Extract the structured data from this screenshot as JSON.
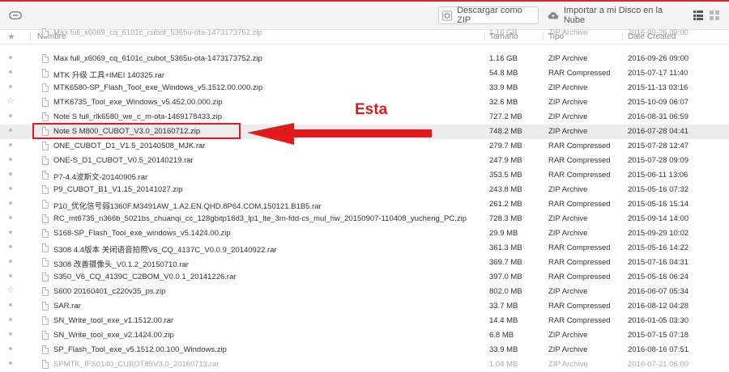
{
  "toolbar": {
    "download_zip_label": "Descargar como ZIP",
    "import_label": "Importar a mi Disco en la Nube"
  },
  "header": {
    "name": "Nombre",
    "size": "Tamaño",
    "type": "Tipo",
    "date": "Date Created"
  },
  "annotation": {
    "label": "Esta",
    "color": "#e11b1b"
  },
  "files": [
    {
      "name": "Max full_x6069_cq_6101c_cubot_5365u-ota-1473173752.zip",
      "size": "1.16 GB",
      "type": "ZIP Archive",
      "date": "2016-09-26 09:00"
    },
    {
      "name": "Max full_x6069_cq_6101c_cubot_5365u-ota-1473173752.zip",
      "size": "1.16 GB",
      "type": "ZIP Archive",
      "date": "2016-09-26 09:00"
    },
    {
      "name": "MTK 升级 工具+IMEI 140325.rar",
      "size": "54.8 MB",
      "type": "RAR Compressed",
      "date": "2015-07-17 11:40"
    },
    {
      "name": "MTK6580-SP_Flash_Tool_exe_Windows_v5.1512.00.000.zip",
      "size": "33.9 MB",
      "type": "ZIP Archive",
      "date": "2015-11-13 03:16"
    },
    {
      "name": "MTK6735_Tool_exe_Windows_v5.452.00.000.zip",
      "size": "32.6 MB",
      "type": "ZIP Archive",
      "date": "2015-10-09 06:07"
    },
    {
      "name": "Note S full_rlk6580_we_c_m-ota-1469178433.zip",
      "size": "727.2 MB",
      "type": "ZIP Archive",
      "date": "2016-08-31 06:59"
    },
    {
      "name": "Note S M800_CUBOT_V3.0_20160712.zip",
      "size": "748.2 MB",
      "type": "ZIP Archive",
      "date": "2016-07-28 04:41"
    },
    {
      "name": "ONE_CUBOT_D1_V1.5_20140508_MJK.rar",
      "size": "279.7 MB",
      "type": "RAR Compressed",
      "date": "2015-07-28 12:47"
    },
    {
      "name": "ONE-S_D1_CUBOT_V0.5_20140219.rar",
      "size": "247.9 MB",
      "type": "RAR Compressed",
      "date": "2015-07-28 09:09"
    },
    {
      "name": "P7-4.4波斯文-20140905.rar",
      "size": "353.5 MB",
      "type": "RAR Compressed",
      "date": "2015-06-11 13:06"
    },
    {
      "name": "P9_CUBOT_B1_V1.15_20141027.zip",
      "size": "243.8 MB",
      "type": "ZIP Archive",
      "date": "2015-05-16 07:32"
    },
    {
      "name": "P10_优化信号弱1360F.M3491AW_1.A2.EN.QHD.8P64.COM.150121.B1B5.rar",
      "size": "261.2 MB",
      "type": "RAR Compressed",
      "date": "2015-05-16 15:14"
    },
    {
      "name": "RC_mt6735_n366b_5021bs_chuanqi_cc_128gbitp16d3_lp1_lte_3m-fdd-cs_mul_hw_20150907-110408_yucheng_PC.zip",
      "size": "728.3 MB",
      "type": "ZIP Archive",
      "date": "2015-09-14 14:00"
    },
    {
      "name": "S168-SP_Flash_Tool_exe_windows_v5.1424.00.zip",
      "size": "29.9 MB",
      "type": "ZIP Archive",
      "date": "2015-09-29 10:02"
    },
    {
      "name": "S308 4.4版本 关闭语音拍照V6_CQ_4137C_V0.0.9_20140922.rar",
      "size": "361.3 MB",
      "type": "RAR Compressed",
      "date": "2015-05-16 14:22"
    },
    {
      "name": "S308 改善摄像头_V0.1.2_20150710.rar",
      "size": "369.7 MB",
      "type": "RAR Compressed",
      "date": "2015-07-16 04:31"
    },
    {
      "name": "S350_V6_CQ_4139C_C2BOM_V0.0.1_20141226.rar",
      "size": "397.0 MB",
      "type": "RAR Compressed",
      "date": "2015-05-16 06:24"
    },
    {
      "name": "S600 20160401_c220v35_ps.zip",
      "size": "802.0 MB",
      "type": "ZIP Archive",
      "date": "2016-06-07 05:34"
    },
    {
      "name": "SAR.rar",
      "size": "33.7 MB",
      "type": "RAR Compressed",
      "date": "2016-08-12 04:28"
    },
    {
      "name": "SN_Write_tool_exe_v1.1512.00.rar",
      "size": "14.4 MB",
      "type": "RAR Compressed",
      "date": "2016-01-05 03:30"
    },
    {
      "name": "SN_Write_tool_exe_v2.1424.00.zip",
      "size": "6.8 MB",
      "type": "ZIP Archive",
      "date": "2015-07-15 07:18"
    },
    {
      "name": "SP_Flash_Tool_exe_v5.1512.00.100_Windows.zip",
      "size": "33.9 MB",
      "type": "ZIP Archive",
      "date": "2016-08-16 07:51"
    },
    {
      "name": "SPMTK_IFS0140_CUBOT85V3.0_20160713.rar",
      "size": "1.04 MB",
      "type": "ZIP Archive",
      "date": "2016-07-21 06:00"
    }
  ]
}
